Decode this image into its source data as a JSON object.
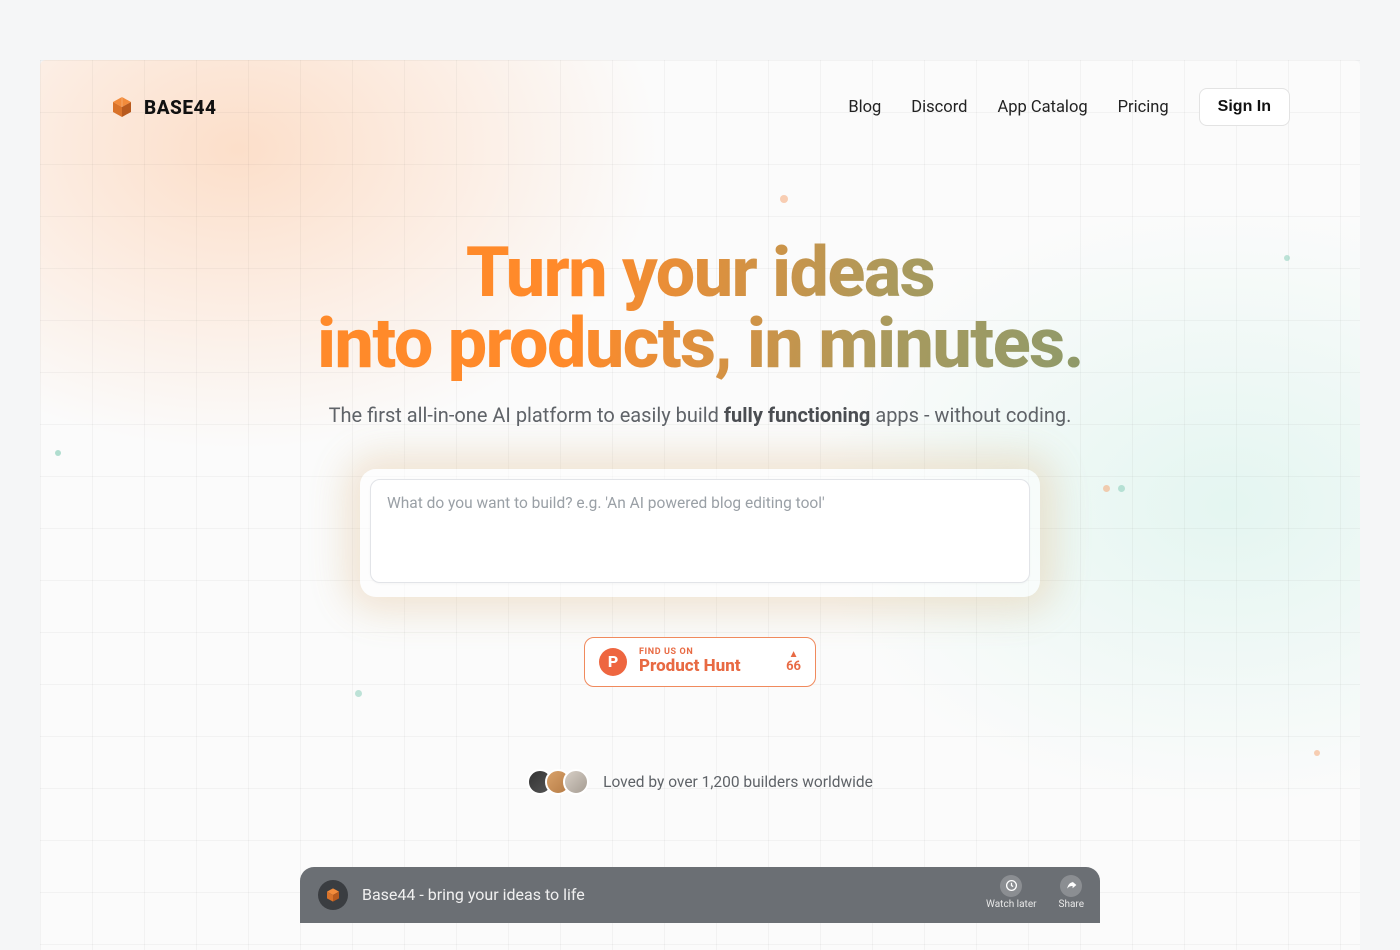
{
  "brand": {
    "name": "BASE44"
  },
  "nav": {
    "links": [
      "Blog",
      "Discord",
      "App Catalog",
      "Pricing"
    ],
    "signin": "Sign In"
  },
  "hero": {
    "headline_line1": "Turn your ideas",
    "headline_line2": "into products, in minutes.",
    "tagline_pre": "The first all-in-one AI platform to easily build ",
    "tagline_bold": "fully functioning",
    "tagline_post": " apps - without coding."
  },
  "prompt": {
    "placeholder": "What do you want to build? e.g. 'An AI powered blog editing tool'",
    "value": ""
  },
  "product_hunt": {
    "kicker": "FIND US ON",
    "name": "Product Hunt",
    "upvotes": "66"
  },
  "social": {
    "text": "Loved by over 1,200 builders worldwide"
  },
  "video": {
    "title": "Base44 - bring your ideas to life",
    "watch_later": "Watch later",
    "share": "Share"
  }
}
